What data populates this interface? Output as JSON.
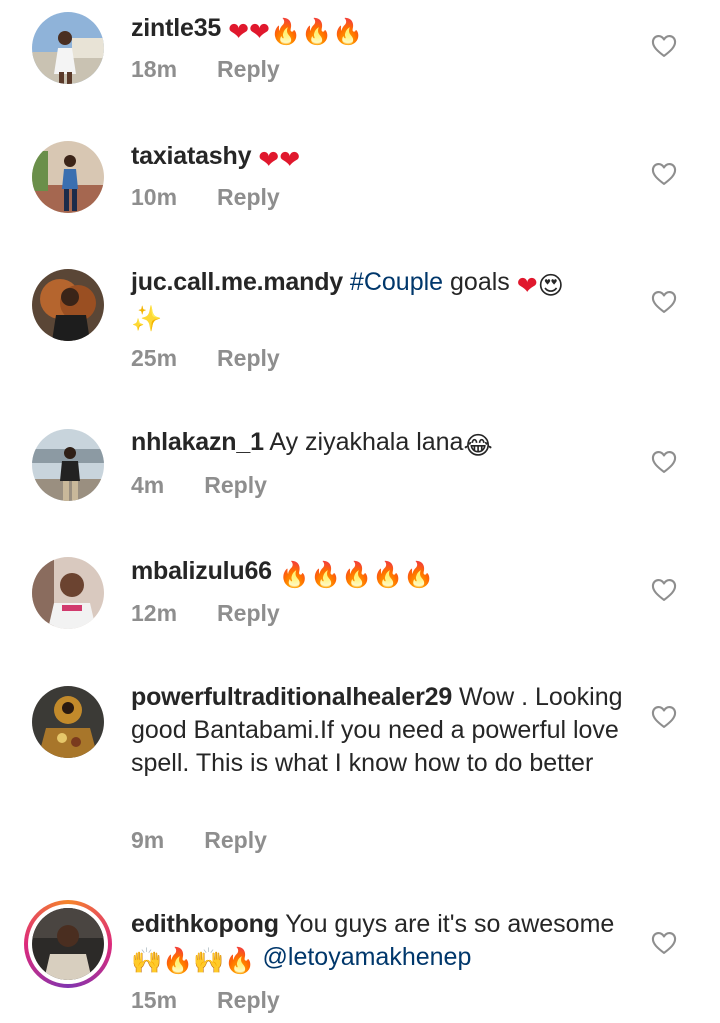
{
  "icons": {
    "like": "heart-outline-icon",
    "red_heart": "red-heart-emoji",
    "fire": "fire-emoji",
    "heart_eyes": "heart-eyes-emoji",
    "sparkles": "sparkles-emoji",
    "tears_of_joy": "tears-of-joy-emoji",
    "raising_hands": "raising-hands-emoji"
  },
  "colors": {
    "text": "#262626",
    "meta": "#8e8e8e",
    "link": "#00376b",
    "emoji_heart": "#e0182d",
    "emoji_fire": "#f07a12"
  },
  "comments": [
    {
      "username": "zintle35",
      "emojis": "❤❤🔥🔥🔥",
      "time": "18m",
      "reply": "Reply"
    },
    {
      "username": "taxiatashy",
      "emojis": "❤❤",
      "time": "10m",
      "reply": "Reply"
    },
    {
      "username": "juc.call.me.mandy",
      "hashtag": "#Couple",
      "text": "goals",
      "emojis": "❤😍✨",
      "time": "25m",
      "reply": "Reply"
    },
    {
      "username": "nhlakazn_1",
      "text": "Ay ziyakhala lana",
      "emojis": "😂",
      "time": "4m",
      "reply": "Reply"
    },
    {
      "username": "mbalizulu66",
      "emojis": "🔥🔥🔥🔥🔥",
      "time": "12m",
      "reply": "Reply"
    },
    {
      "username": "powerfultraditionalhealer29",
      "text": "Wow . Looking good Bantabami.If you need a powerful love spell. This is what I know how to do better",
      "time": "9m",
      "reply": "Reply"
    },
    {
      "username": "edithkopong",
      "text": "You guys are it's so awesome",
      "emojis": "🙌🔥🙌🔥",
      "mention": "@letoyamakhenep",
      "time": "15m",
      "reply": "Reply"
    }
  ]
}
